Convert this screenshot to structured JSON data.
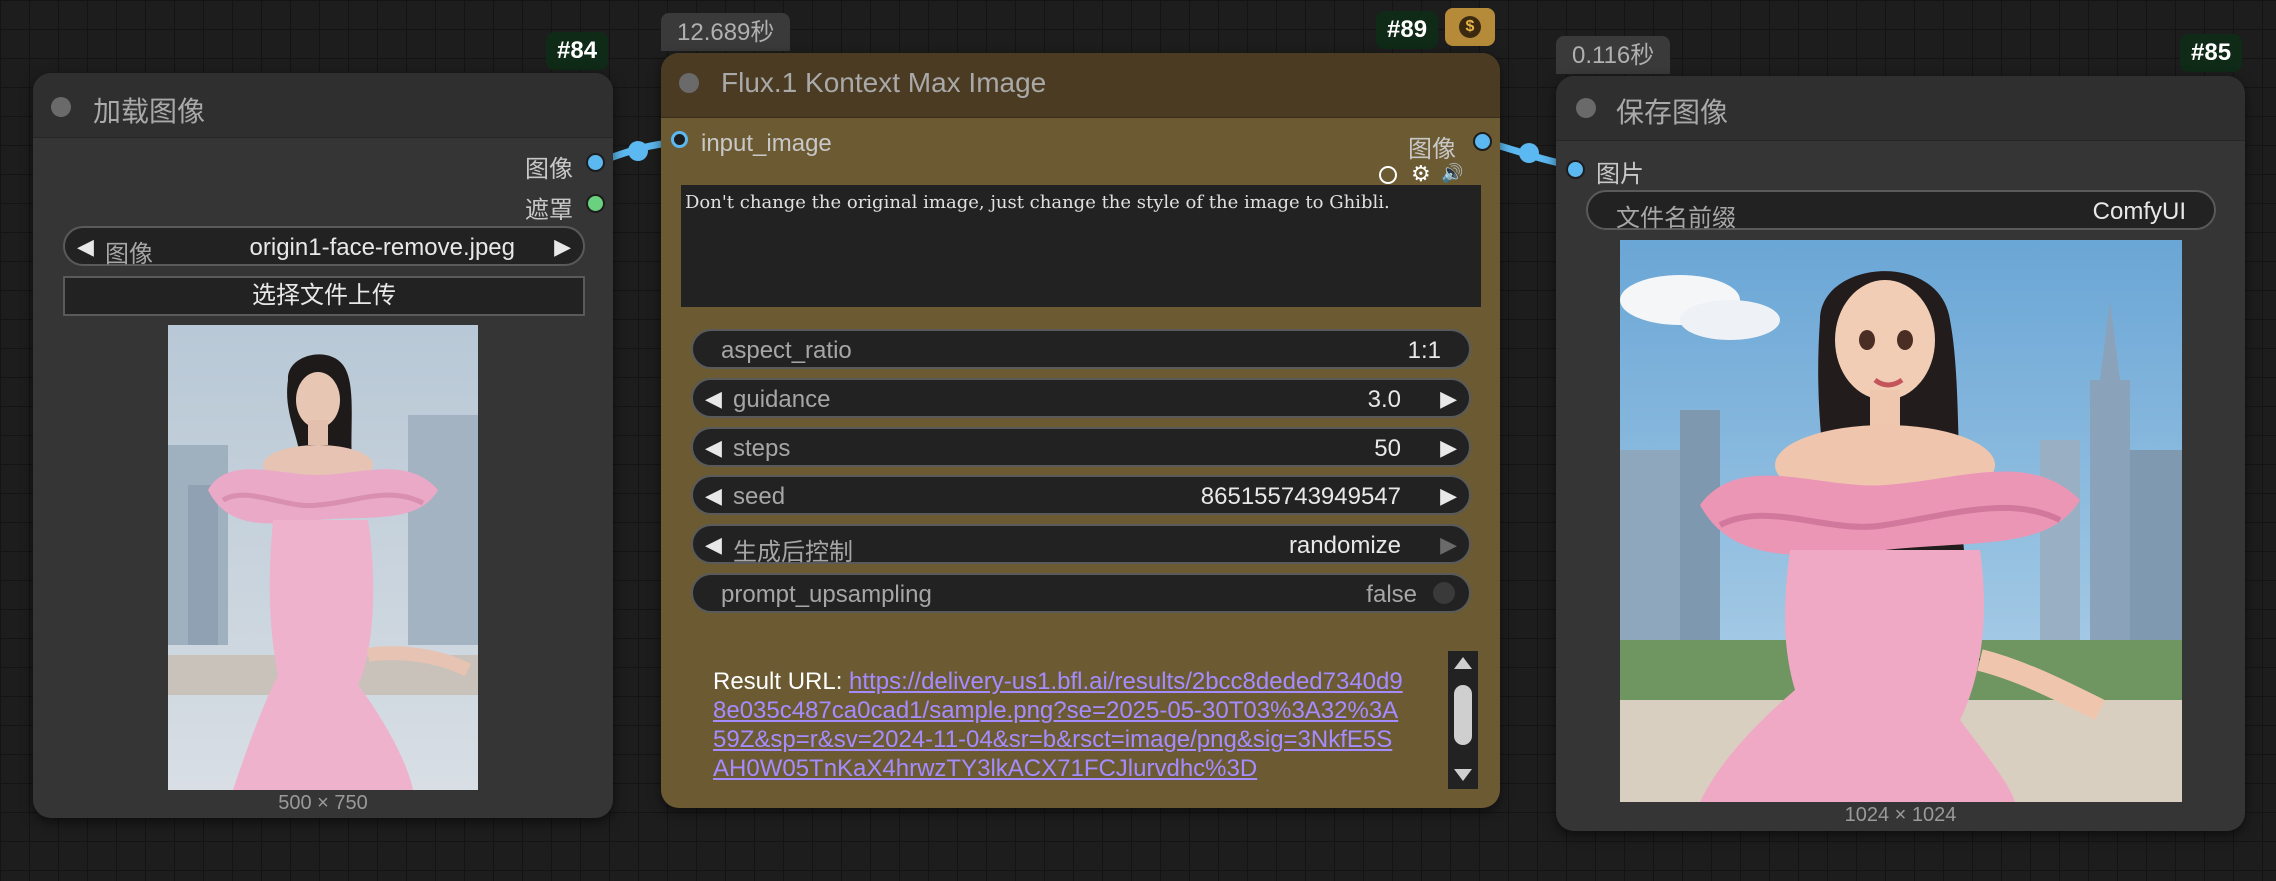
{
  "colors": {
    "accent_link": "#5cb8f0",
    "mask_port": "#6ad27e",
    "flux_node_bg": "#6b5a32",
    "flux_title_bg": "#4a3b22",
    "url_link": "#a48cff"
  },
  "load_node": {
    "id_badge": "#84",
    "title": "加载图像",
    "out_image": "图像",
    "out_mask": "遮罩",
    "image_widget_label": "图像",
    "image_widget_value": "origin1-face-remove.jpeg",
    "upload_button": "选择文件上传",
    "image_size": "500 × 750"
  },
  "flux_node": {
    "id_badge": "#89",
    "time": "12.689秒",
    "title": "Flux.1 Kontext Max Image",
    "in_input_image": "input_image",
    "out_image": "图像",
    "prompt": "Don't change the original image, just change the style of the image to Ghibli.",
    "widgets": [
      {
        "label": "aspect_ratio",
        "value": "1:1"
      },
      {
        "label": "guidance",
        "value": "3.0"
      },
      {
        "label": "steps",
        "value": "50"
      },
      {
        "label": "seed",
        "value": "865155743949547"
      },
      {
        "label": "生成后控制",
        "value": "randomize"
      },
      {
        "label": "prompt_upsampling",
        "value": "false"
      }
    ],
    "result_label": "Result URL: ",
    "result_url_lines": [
      "https://delivery-us1.bfl.ai/results/2bcc8deded7340d9",
      "8e035c487ca0cad1/sample.png?se=2025-05-30T03%3A32%3A",
      "59Z&sp=r&sv=2024-11-04&sr=b&rsct=image/png&sig=3NkfE5S",
      "AH0W05TnKaX4hrwzTY3lkACX71FCJlurvdhc%3D"
    ]
  },
  "save_node": {
    "id_badge": "#85",
    "time": "0.116秒",
    "title": "保存图像",
    "in_images": "图片",
    "prefix_label": "文件名前缀",
    "prefix_value": "ComfyUI",
    "image_size": "1024 × 1024"
  }
}
